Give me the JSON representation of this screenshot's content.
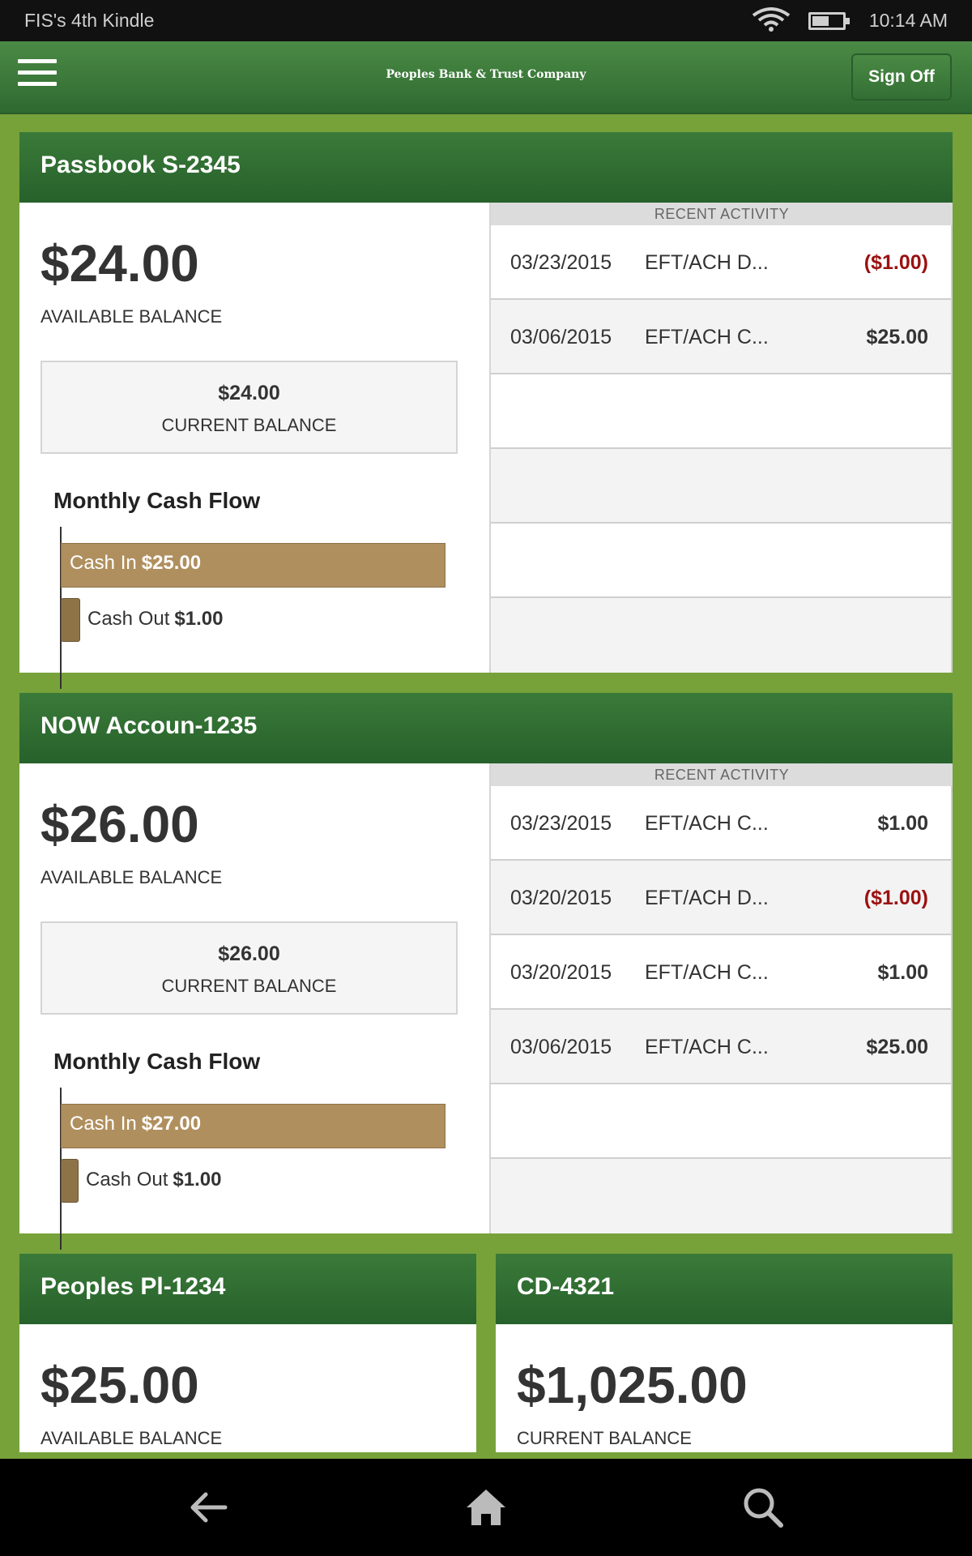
{
  "status_bar": {
    "device_name": "FIS's 4th Kindle",
    "time": "10:14 AM"
  },
  "header": {
    "bank_name": "Peoples Bank & Trust Company",
    "sign_off_label": "Sign Off"
  },
  "accounts": [
    {
      "name": "Passbook S-2345",
      "available_balance": "$24.00",
      "available_label": "AVAILABLE BALANCE",
      "current_balance": "$24.00",
      "current_label": "CURRENT BALANCE",
      "cash_flow_title": "Monthly Cash Flow",
      "cash_in_label": "Cash In",
      "cash_in_value": "$25.00",
      "cash_out_label": "Cash Out",
      "cash_out_value": "$1.00",
      "recent_activity_label": "RECENT ACTIVITY",
      "activity": [
        {
          "date": "03/23/2015",
          "desc": "EFT/ACH D...",
          "amount": "($1.00)"
        },
        {
          "date": "03/06/2015",
          "desc": "EFT/ACH C...",
          "amount": "$25.00"
        }
      ]
    },
    {
      "name": "NOW Accoun-1235",
      "available_balance": "$26.00",
      "available_label": "AVAILABLE BALANCE",
      "current_balance": "$26.00",
      "current_label": "CURRENT BALANCE",
      "cash_flow_title": "Monthly Cash Flow",
      "cash_in_label": "Cash In",
      "cash_in_value": "$27.00",
      "cash_out_label": "Cash Out",
      "cash_out_value": "$1.00",
      "recent_activity_label": "RECENT ACTIVITY",
      "activity": [
        {
          "date": "03/23/2015",
          "desc": "EFT/ACH C...",
          "amount": "$1.00"
        },
        {
          "date": "03/20/2015",
          "desc": "EFT/ACH D...",
          "amount": "($1.00)"
        },
        {
          "date": "03/20/2015",
          "desc": "EFT/ACH C...",
          "amount": "$1.00"
        },
        {
          "date": "03/06/2015",
          "desc": "EFT/ACH C...",
          "amount": "$25.00"
        }
      ]
    },
    {
      "name": "Peoples Pl-1234",
      "balance": "$25.00",
      "label": "AVAILABLE BALANCE"
    },
    {
      "name": "CD-4321",
      "balance": "$1,025.00",
      "label": "CURRENT BALANCE"
    }
  ],
  "icons": {
    "wifi": "wifi-icon",
    "battery": "battery-icon",
    "menu": "menu-icon",
    "back": "back-arrow-icon",
    "home": "home-icon",
    "search": "search-icon"
  },
  "colors": {
    "header_green": "#2e6a31",
    "page_green": "#77a23a",
    "cash_in_bar": "#b08f5e",
    "negative": "#9b1111"
  }
}
